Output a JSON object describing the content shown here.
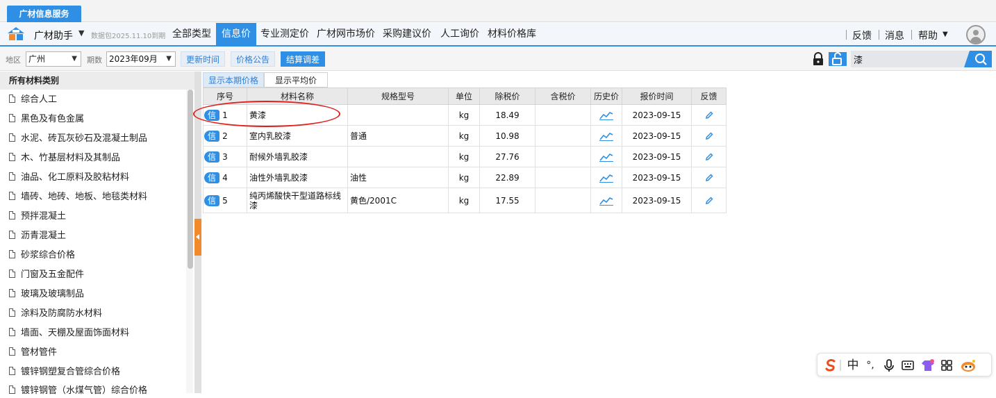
{
  "app": {
    "title": "广材信息服务"
  },
  "menubar": {
    "brand": "广材助手",
    "package_note": "数据包2025.11.10到期",
    "nav": [
      "全部类型",
      "信息价",
      "专业测定价",
      "广材网市场价",
      "采购建议价",
      "人工询价",
      "材料价格库"
    ],
    "active_nav": "信息价",
    "right": {
      "feedback": "反馈",
      "messages": "消息",
      "help": "帮助"
    }
  },
  "filters": {
    "region_label": "地区",
    "region_value": "广州",
    "period_label": "期数",
    "period_value": "2023年09月",
    "update_time": "更新时间",
    "price_notice": "价格公告",
    "settle_adjust": "结算调差"
  },
  "search": {
    "value": "漆"
  },
  "sidebar": {
    "header": "所有材料类别",
    "items": [
      "综合人工",
      "黑色及有色金属",
      "水泥、砖瓦灰砂石及混凝土制品",
      "木、竹基层材料及其制品",
      "油品、化工原料及胶粘材料",
      "墙砖、地砖、地板、地毯类材料",
      "预拌混凝土",
      "沥青混凝土",
      "砂浆综合价格",
      "门窗及五金配件",
      "玻璃及玻璃制品",
      "涂料及防腐防水材料",
      "墙面、天棚及屋面饰面材料",
      "管材管件",
      "镀锌钢塑复合管综合价格",
      "镀锌钢管（水煤气管）综合价格"
    ]
  },
  "tabs": {
    "current": "显示本期价格",
    "average": "显示平均价"
  },
  "table": {
    "headers": [
      "序号",
      "材料名称",
      "规格型号",
      "单位",
      "除税价",
      "含税价",
      "历史价",
      "报价时间",
      "反馈"
    ],
    "badge": "信",
    "rows": [
      {
        "seq": "1",
        "name": "黄漆",
        "spec": "",
        "unit": "kg",
        "price_ex": "18.49",
        "price_inc": "",
        "date": "2023-09-15"
      },
      {
        "seq": "2",
        "name": "室内乳胶漆",
        "spec": "普通",
        "unit": "kg",
        "price_ex": "10.98",
        "price_inc": "",
        "date": "2023-09-15"
      },
      {
        "seq": "3",
        "name": "耐候外墙乳胶漆",
        "spec": "",
        "unit": "kg",
        "price_ex": "27.76",
        "price_inc": "",
        "date": "2023-09-15"
      },
      {
        "seq": "4",
        "name": "油性外墙乳胶漆",
        "spec": "油性",
        "unit": "kg",
        "price_ex": "22.89",
        "price_inc": "",
        "date": "2023-09-15"
      },
      {
        "seq": "5",
        "name": "纯丙烯酸快干型道路标线漆",
        "spec": "黄色/2001C",
        "unit": "kg",
        "price_ex": "17.55",
        "price_inc": "",
        "date": "2023-09-15"
      }
    ]
  },
  "ime": {
    "lang": "中"
  },
  "colors": {
    "accent": "#2f8fe4",
    "highlight": "#e02020",
    "handle": "#f08a2a"
  }
}
